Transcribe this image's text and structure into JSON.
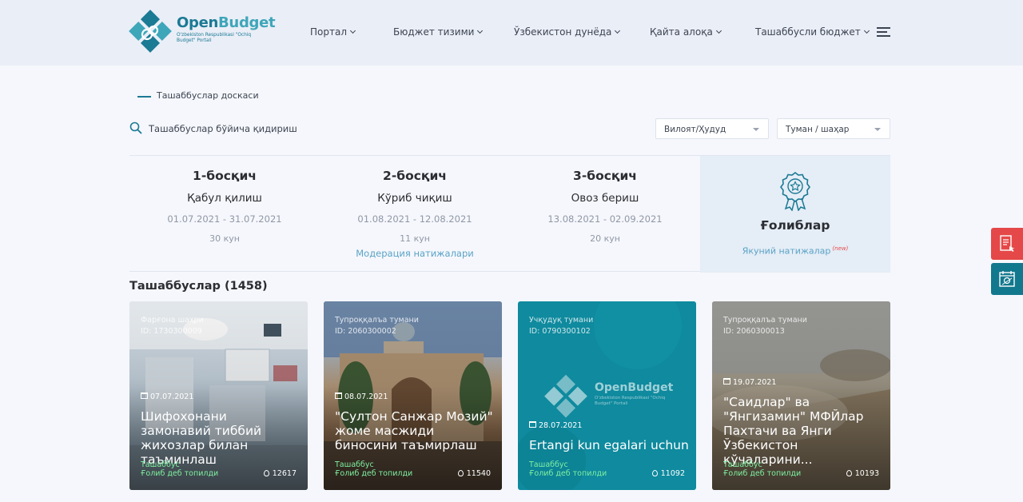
{
  "header": {
    "logo": {
      "title_open": "Open",
      "title_budget": "Budget",
      "subtitle": "O'zbekiston Respublikasi \"Ochiq Budget\" Portali"
    },
    "nav": [
      {
        "label": "Портал"
      },
      {
        "label": "Бюджет тизими"
      },
      {
        "label": "Ўзбекистон дунёда"
      },
      {
        "label": "Қайта алоқа"
      },
      {
        "label": "Ташаббусли бюджет"
      }
    ]
  },
  "breadcrumb": {
    "label": "Ташаббуслар доскаси"
  },
  "search": {
    "placeholder": "Ташаббуслар бўйича қидириш"
  },
  "filters": {
    "region": "Вилоят/Ҳудуд",
    "district": "Туман / шаҳар"
  },
  "stages": [
    {
      "num": "1-босқич",
      "name": "Қабул қилиш",
      "dates": "01.07.2021 - 31.07.2021",
      "days": "30 кун",
      "link": ""
    },
    {
      "num": "2-босқич",
      "name": "Кўриб чиқиш",
      "dates": "01.08.2021 - 12.08.2021",
      "days": "11 кун",
      "link": "Модерация натижалари"
    },
    {
      "num": "3-босқич",
      "name": "Овоз бериш",
      "dates": "13.08.2021 - 02.09.2021",
      "days": "20 кун",
      "link": ""
    }
  ],
  "winners": {
    "title": "Ғолиблар",
    "link": "Якуний натижалар",
    "badge": "(new)"
  },
  "initiatives": {
    "title": "Ташаббуслар (1458)",
    "cards": [
      {
        "location": "Фарғона шаҳри",
        "id": "ID: 1730300009",
        "date": "07.07.2021",
        "title": "Шифохонани замонавий тиббий жихозлар билан таъминлаш",
        "kind": "Ташаббус",
        "status": "Ғолиб деб топилди",
        "votes": "12617"
      },
      {
        "location": "Тупроққалъа тумани",
        "id": "ID: 2060300002",
        "date": "08.07.2021",
        "title": "\"Султон Санжар Мозий\" жоме масжиди биносини таъмирлаш",
        "kind": "Ташаббус",
        "status": "Ғолиб деб топилди",
        "votes": "11540"
      },
      {
        "location": "Учқудуқ тумани",
        "id": "ID: 0790300102",
        "date": "28.07.2021",
        "title": "Ertangi kun egalari uchun",
        "kind": "Ташаббус",
        "status": "Ғолиб деб топилди",
        "votes": "11092"
      },
      {
        "location": "Тупроққалъа тумани",
        "id": "ID: 2060300013",
        "date": "19.07.2021",
        "title": "\"Саидлар\" ва \"Янгизамин\" МФЙлар Пахтачи ва Янги Ўзбекистон кўчаларини...",
        "kind": "Ташаббус",
        "status": "Ғолиб деб топилди",
        "votes": "10193"
      }
    ]
  },
  "icons": {
    "search": "search-icon",
    "menu": "hamburger-menu-icon",
    "medal": "award-medal-icon",
    "float_top": "survey-form-icon",
    "float_bottom": "calendar-map-icon"
  },
  "colors": {
    "accent": "#1b7a94",
    "link": "#5aa3c6",
    "float_red": "#e54848",
    "float_teal": "#12788d",
    "status_green": "#7ef0a0"
  }
}
